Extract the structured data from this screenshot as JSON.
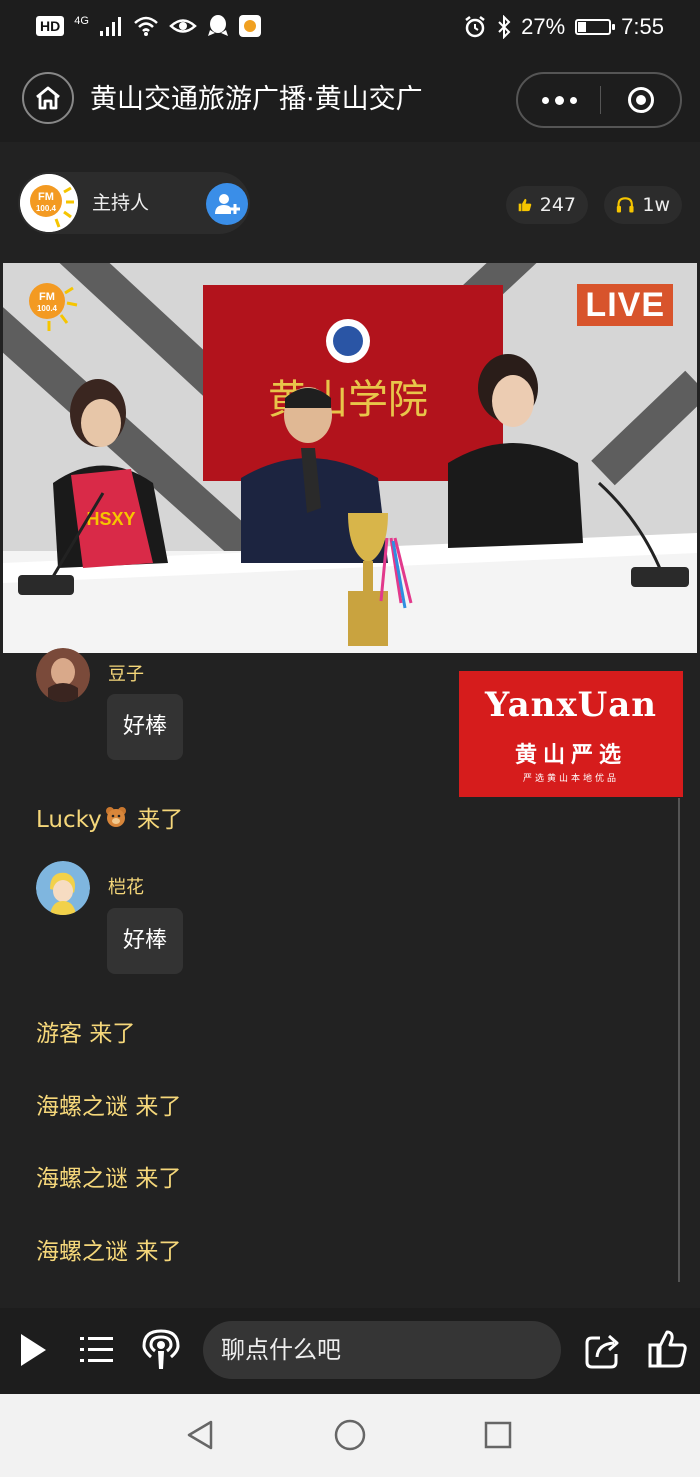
{
  "status_bar": {
    "left_badge": "HD",
    "network": "4G",
    "battery": "27%",
    "battery_level": 0.27,
    "time": "7:55"
  },
  "title_bar": {
    "title": "黄山交通旅游广播·黄山交广"
  },
  "host": {
    "label": "主持人",
    "avatar_text": "FM 100.4"
  },
  "stats": {
    "likes": "247",
    "listeners": "1w"
  },
  "video": {
    "live_badge": "LIVE",
    "logo_text": "FM 100.4",
    "banner_text": "黄山学院"
  },
  "ad": {
    "title": "YanxUan",
    "subtitle": "黄山严选",
    "tagline": "严选黄山本地优品"
  },
  "chat": {
    "messages": [
      {
        "user": "豆子",
        "text": "好棒"
      },
      {
        "user": "桤花",
        "text": "好棒"
      }
    ],
    "joins": [
      {
        "user": "Lucky",
        "verb": "来了"
      },
      {
        "user": "游客",
        "verb": "来了"
      },
      {
        "user": "海螺之谜",
        "verb": "来了"
      },
      {
        "user": "海螺之谜",
        "verb": "来了"
      },
      {
        "user": "海螺之谜",
        "verb": "来了"
      }
    ]
  },
  "input": {
    "placeholder": "聊点什么吧"
  },
  "colors": {
    "accent_blue": "#3a8ee8",
    "live_red": "#d8542c",
    "chat_gold": "#f5d77a",
    "ad_red": "#d61c1c"
  }
}
